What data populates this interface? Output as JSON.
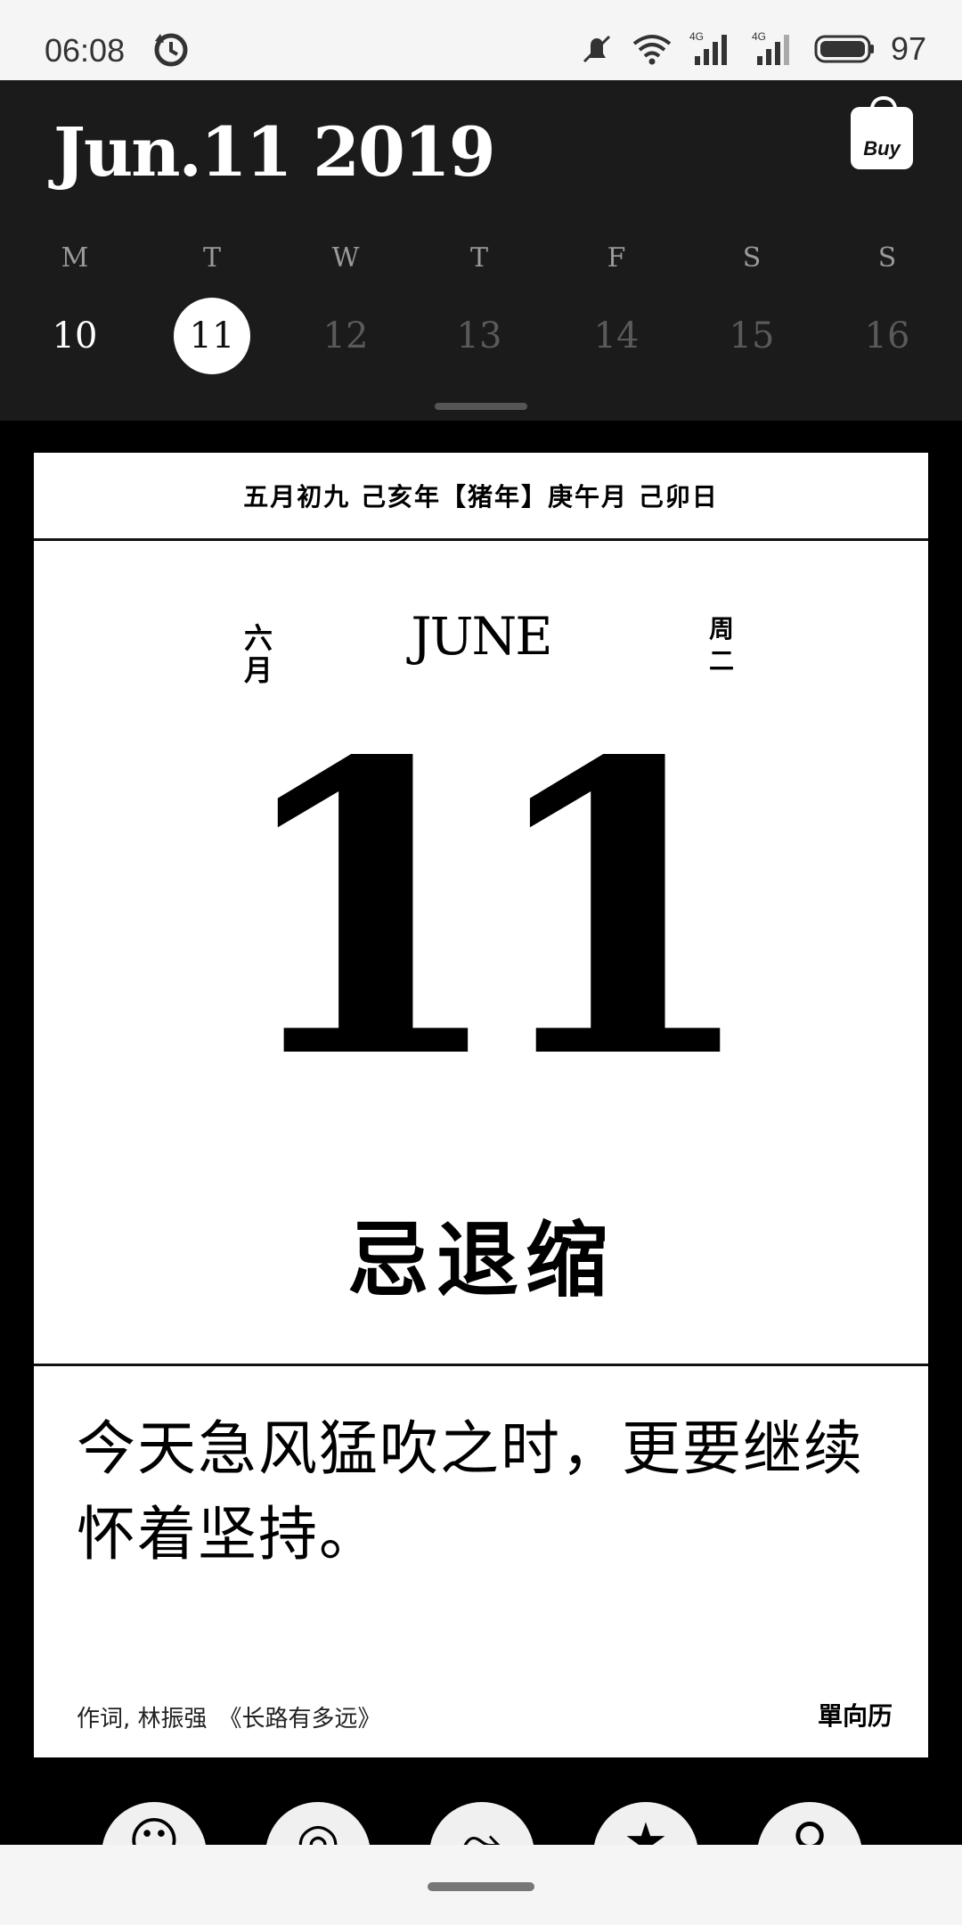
{
  "status_bar": {
    "time": "06:08",
    "battery": "97",
    "icons": [
      "sync-icon",
      "bell-off-icon",
      "wifi-icon",
      "signal-4g-icon",
      "signal-4g-icon",
      "battery-icon"
    ]
  },
  "header": {
    "date_title": "Jun.11 2019",
    "buy_label": "Buy",
    "week": [
      {
        "day": "M",
        "num": "10",
        "state": "past"
      },
      {
        "day": "T",
        "num": "11",
        "state": "active"
      },
      {
        "day": "W",
        "num": "12",
        "state": "future"
      },
      {
        "day": "T",
        "num": "13",
        "state": "future"
      },
      {
        "day": "F",
        "num": "14",
        "state": "future"
      },
      {
        "day": "S",
        "num": "15",
        "state": "future"
      },
      {
        "day": "S",
        "num": "16",
        "state": "future"
      }
    ]
  },
  "card": {
    "lunar": "五月初九 己亥年【猪年】庚午月 己卯日",
    "month_cn_1": "六",
    "month_cn_2": "月",
    "month_en": "JUNE",
    "weekday_cn_1": "周",
    "weekday_cn_2": "二",
    "day": "11",
    "avoid": "忌退缩",
    "quote_line1": "今天急风猛吹之时，更要继续",
    "quote_line2": "怀着坚持。",
    "credit": "作词, 林振强　《长路有多远》",
    "brand": "單向历"
  },
  "colors": {
    "header_bg": "#1b1b1b",
    "card_bg": "#ffffff",
    "page_bg": "#000000"
  }
}
